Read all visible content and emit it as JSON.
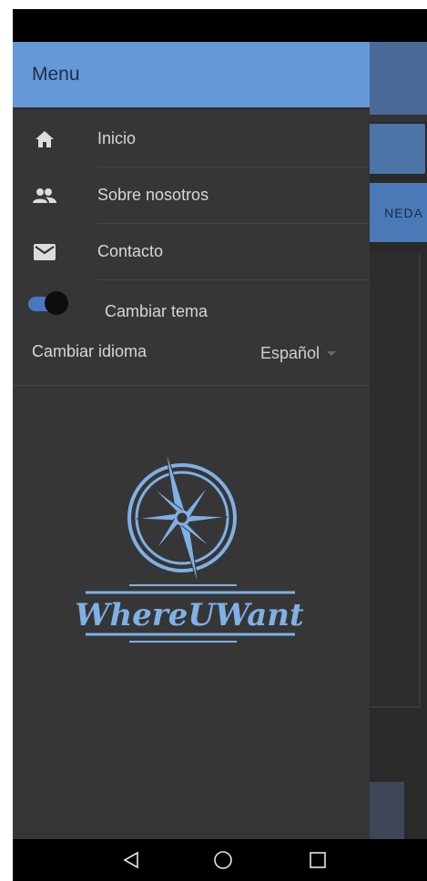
{
  "drawer": {
    "title": "Menu",
    "items": [
      {
        "label": "Inicio",
        "icon": "home-icon"
      },
      {
        "label": "Sobre nosotros",
        "icon": "people-icon"
      },
      {
        "label": "Contacto",
        "icon": "mail-icon"
      }
    ],
    "theme_toggle": {
      "label": "Cambiar tema",
      "state": "on"
    },
    "language": {
      "label": "Cambiar idioma",
      "selected": "Español"
    }
  },
  "logo": {
    "text": "WhereUWant"
  },
  "background": {
    "button_label": "NEDA"
  },
  "colors": {
    "accent": "#6498d8",
    "drawer_bg": "#363636",
    "toggle_track": "#4a78c0",
    "logo_blue": "#7fb0e6"
  }
}
